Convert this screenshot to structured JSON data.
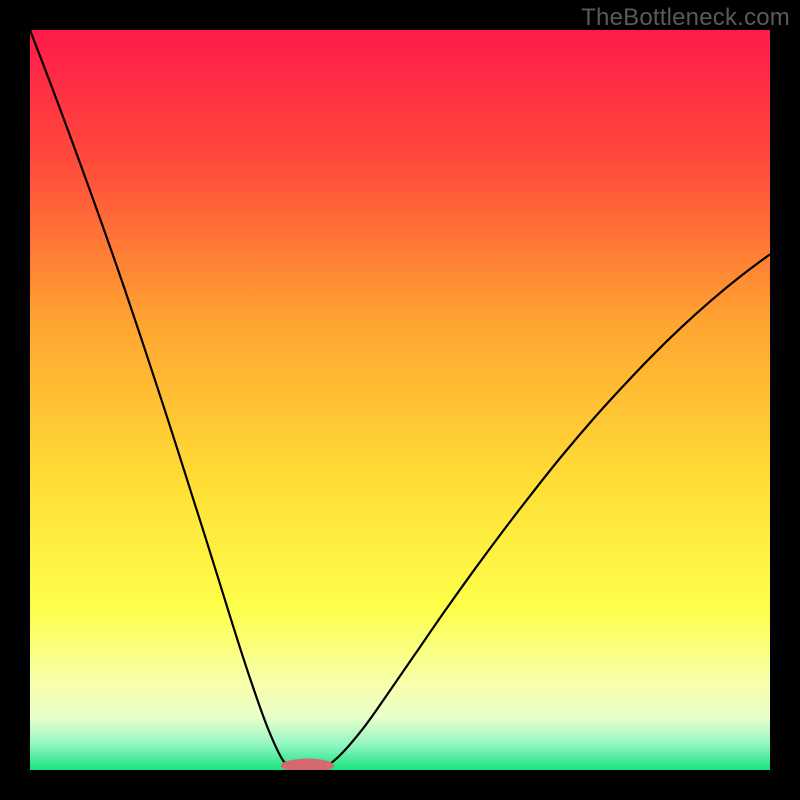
{
  "watermark": "TheBottleneck.com",
  "chart_data": {
    "type": "line",
    "title": "",
    "xlabel": "",
    "ylabel": "",
    "xlim": [
      0,
      100
    ],
    "ylim": [
      0,
      100
    ],
    "grid": false,
    "background_gradient": [
      {
        "stop": 0.0,
        "color": "#ff1a4b"
      },
      {
        "stop": 0.18,
        "color": "#ff4b3a"
      },
      {
        "stop": 0.4,
        "color": "#ffa631"
      },
      {
        "stop": 0.62,
        "color": "#ffe036"
      },
      {
        "stop": 0.78,
        "color": "#fdff4a"
      },
      {
        "stop": 0.88,
        "color": "#f8ffa8"
      },
      {
        "stop": 0.93,
        "color": "#e7ffc9"
      },
      {
        "stop": 0.965,
        "color": "#93f6c3"
      },
      {
        "stop": 1.0,
        "color": "#18e37e"
      }
    ],
    "series": [
      {
        "name": "left-curve",
        "stroke": "#000000",
        "x": [
          0,
          2,
          4,
          6,
          8,
          10,
          12,
          14,
          16,
          18,
          20,
          22,
          24,
          26,
          28,
          30,
          32,
          34,
          35.5
        ],
        "y": [
          100,
          94.8,
          89.5,
          84.1,
          78.6,
          73.0,
          67.3,
          61.4,
          55.4,
          49.3,
          43.1,
          36.8,
          30.5,
          24.1,
          17.7,
          11.6,
          6.0,
          1.6,
          0.0
        ]
      },
      {
        "name": "right-curve",
        "stroke": "#000000",
        "x": [
          39.5,
          42,
          45,
          48,
          52,
          56,
          60,
          64,
          68,
          72,
          76,
          80,
          84,
          88,
          92,
          96,
          100
        ],
        "y": [
          0.0,
          2.1,
          5.6,
          9.8,
          15.6,
          21.4,
          27.0,
          32.4,
          37.6,
          42.6,
          47.3,
          51.7,
          55.9,
          59.8,
          63.4,
          66.7,
          69.7
        ]
      }
    ],
    "marker": {
      "name": "bottleneck-marker",
      "cx": 37.5,
      "cy": 0.6,
      "rx": 3.6,
      "ry": 0.95,
      "fill": "#d46a6f"
    }
  }
}
